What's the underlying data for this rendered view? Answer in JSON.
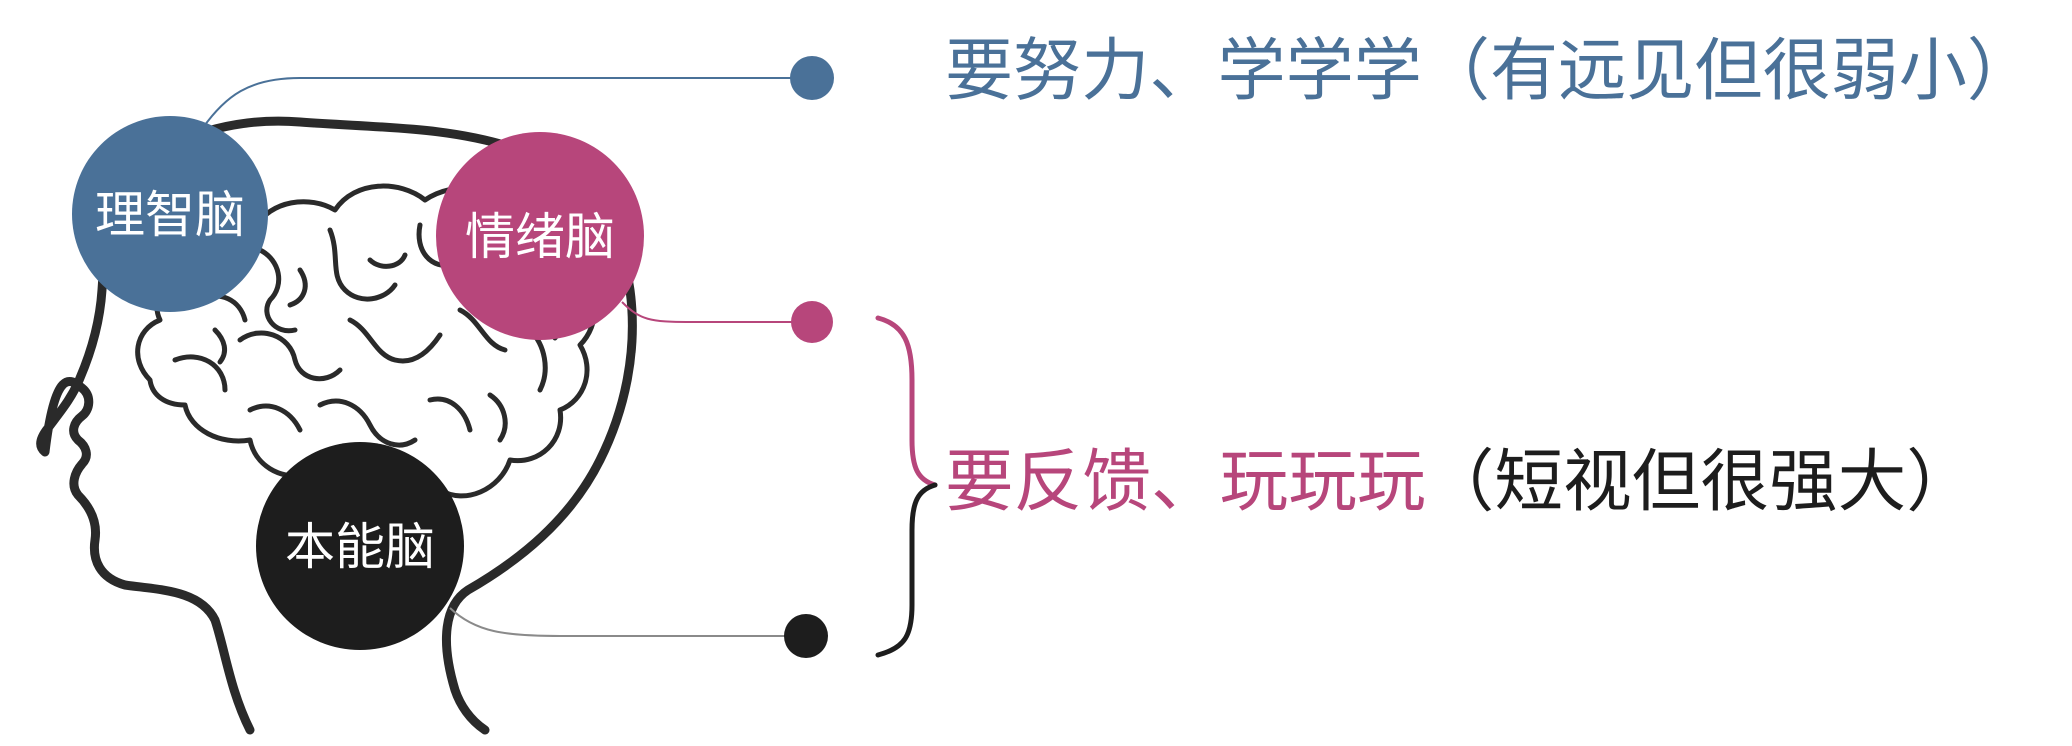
{
  "colors": {
    "rational": "#4a7198",
    "emotional": "#b7467b",
    "instinct": "#1d1d1d",
    "outline": "#2a2a2a",
    "connector": "#8a8a8a"
  },
  "nodes": {
    "rational": {
      "label": "理智脑"
    },
    "emotional": {
      "label": "情绪脑"
    },
    "instinct": {
      "label": "本能脑"
    }
  },
  "descriptions": {
    "rational": {
      "text": "要努力、学学学（有远见但很弱小）"
    },
    "feedback": {
      "main": "要反馈、玩玩玩",
      "note": "（短视但很强大）"
    }
  },
  "icons": {
    "head": "human-head-profile-icon",
    "brain": "brain-icon"
  }
}
